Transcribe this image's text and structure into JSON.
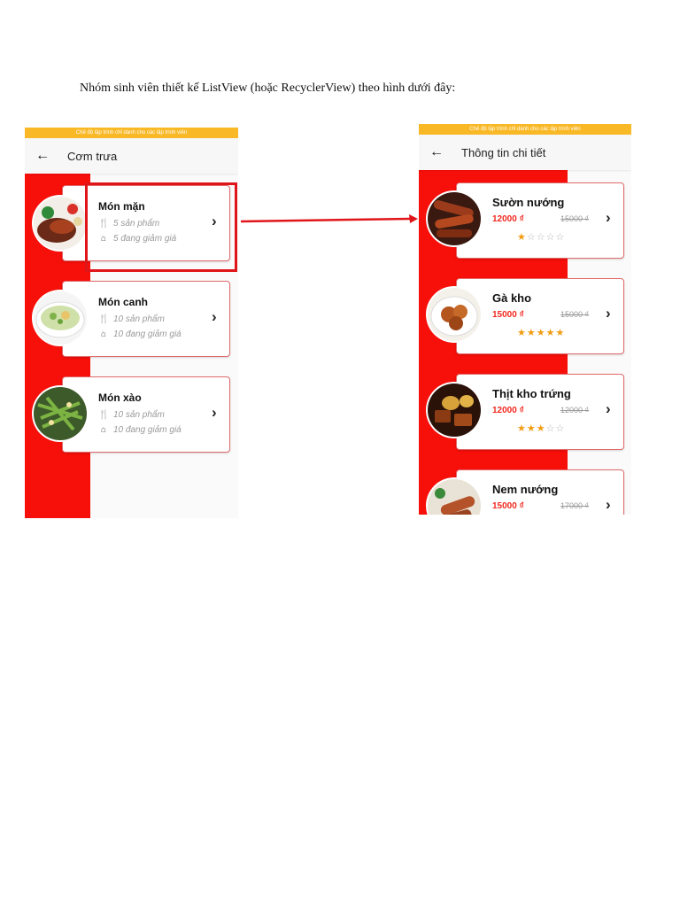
{
  "document": {
    "instruction": "Nhóm sinh viên thiết kế ListView (hoặc RecyclerView) theo hình dưới đây:"
  },
  "list_screen": {
    "status_text": "Chế độ lập trình chỉ dành cho các lập trình viên",
    "title": "Cơm trưa",
    "back_icon": "←",
    "categories": [
      {
        "name": "Món mặn",
        "products": "5 sản phẩm",
        "discounts": "5 đang giảm giá",
        "image": "grilled-pork-plate"
      },
      {
        "name": "Món canh",
        "products": "10 sản phẩm",
        "discounts": "10 đang giảm giá",
        "image": "soup-bowl"
      },
      {
        "name": "Món xào",
        "products": "10 sản phẩm",
        "discounts": "10 đang giảm giá",
        "image": "stir-fried-greens"
      }
    ]
  },
  "detail_screen": {
    "status_text": "Chế độ lập trình chỉ dành cho các lập trình viên",
    "title": "Thông tin chi tiết",
    "back_icon": "←",
    "dishes": [
      {
        "name": "Sườn nướng",
        "price": "12000 ₫",
        "old_price": "15000 ₫",
        "rating": 1,
        "image": "grilled-ribs"
      },
      {
        "name": "Gà kho",
        "price": "15000 ₫",
        "old_price": "15000 ₫",
        "rating": 5,
        "image": "braised-chicken"
      },
      {
        "name": "Thịt kho trứng",
        "price": "12000 ₫",
        "old_price": "12000 ₫",
        "rating": 3,
        "image": "braised-pork-eggs"
      },
      {
        "name": "Nem nướng",
        "price": "15000 ₫",
        "old_price": "17000 ₫",
        "rating": null,
        "image": "grilled-pork-sausage"
      }
    ]
  },
  "colors": {
    "brand_red": "#f70f0a",
    "status_bar": "#f9b826",
    "price_red": "#f2281e",
    "star": "#f39c12"
  },
  "icons": {
    "chevron": "chevron-right-icon",
    "utensils": "fork-knife-icon",
    "discount": "sale-tag-icon",
    "back": "back-arrow-icon"
  }
}
